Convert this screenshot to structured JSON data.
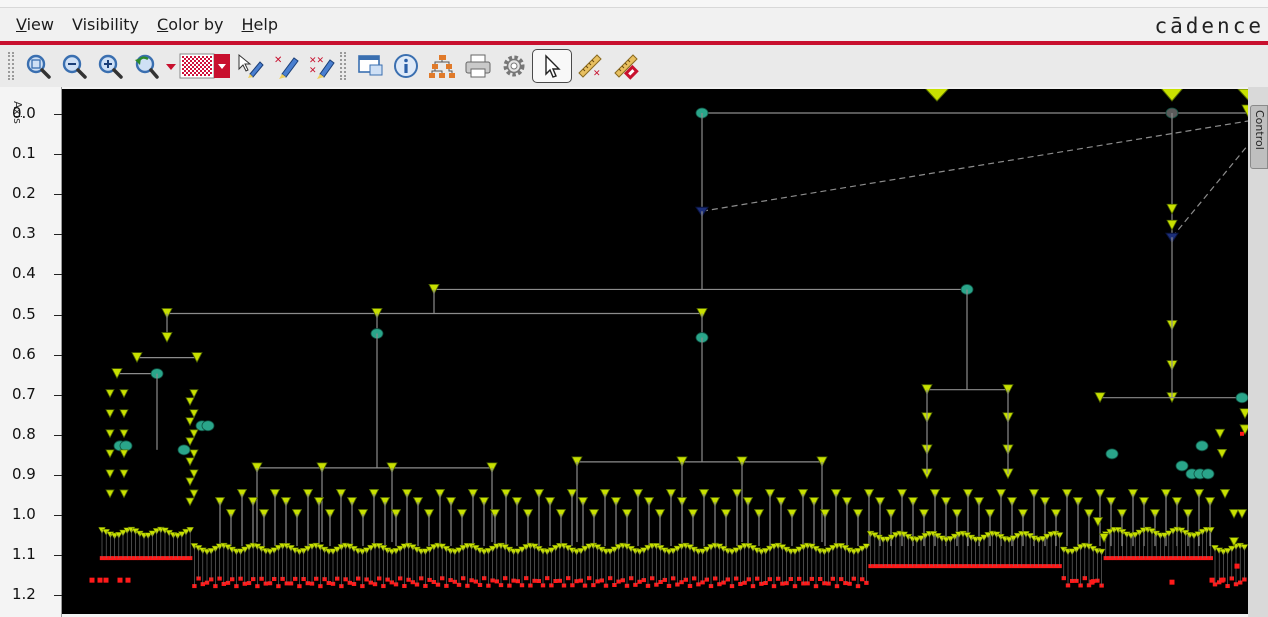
{
  "menu": {
    "items": [
      {
        "label": "View",
        "mnemonic": "V",
        "rest": "iew"
      },
      {
        "label": "Visibility",
        "mnemonic": "V",
        "rest": "isibility"
      },
      {
        "label": "Color by",
        "mnemonic": "C",
        "rest": "olor by"
      },
      {
        "label": "Help",
        "mnemonic": "H",
        "rest": "elp"
      }
    ],
    "brand": "cādence"
  },
  "toolbar": {
    "icons": [
      "zoom-fit-icon",
      "zoom-out-icon",
      "zoom-in-icon",
      "zoom-undo-icon",
      "dropdown-arrow-icon",
      "fill-pattern-icon",
      "select-net-icon",
      "highlight-net-icon",
      "unhighlight-net-icon",
      "window-icon",
      "info-icon",
      "hierarchy-icon",
      "print-icon",
      "settings-icon",
      "pointer-icon",
      "ruler-icon",
      "ruler-clear-icon"
    ]
  },
  "plot": {
    "side_tab": "Axis",
    "right_tab": "Control",
    "y_ticks": [
      "0.0",
      "0.1",
      "0.2",
      "0.3",
      "0.4",
      "0.5",
      "0.6",
      "0.7",
      "0.8",
      "0.9",
      "1.0",
      "1.1",
      "1.2"
    ],
    "y_range": [
      0.0,
      1.2
    ],
    "colors": {
      "background": "#000000",
      "wire": "#8c8c8c",
      "buffer": "#c8e000",
      "buffer_outline": "#556b00",
      "node": "#2aa58a",
      "root_driver": "#1c2f7a",
      "sink": "#ff1a1a"
    }
  }
}
